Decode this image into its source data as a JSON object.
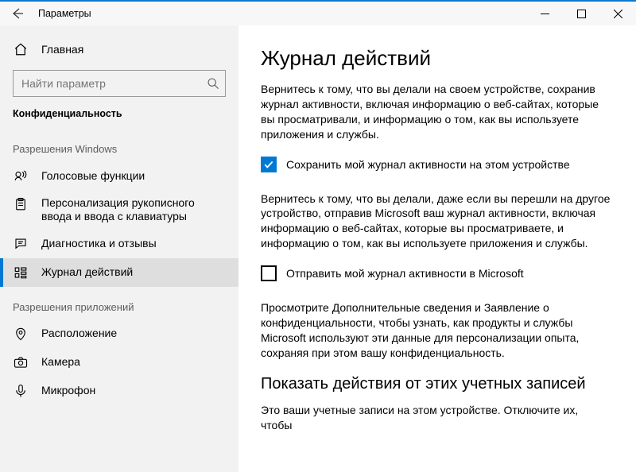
{
  "titlebar": {
    "title": "Параметры"
  },
  "sidebar": {
    "home": "Главная",
    "search_placeholder": "Найти параметр",
    "category": "Конфиденциальность",
    "section_windows": "Разрешения Windows",
    "items_windows": [
      {
        "label": "Голосовые функции"
      },
      {
        "label": "Персонализация рукописного ввода и ввода с клавиатуры"
      },
      {
        "label": "Диагностика и отзывы"
      },
      {
        "label": "Журнал действий"
      }
    ],
    "section_apps": "Разрешения приложений",
    "items_apps": [
      {
        "label": "Расположение"
      },
      {
        "label": "Камера"
      },
      {
        "label": "Микрофон"
      }
    ]
  },
  "content": {
    "title": "Журнал действий",
    "para1": "Вернитесь к тому, что вы делали на своем устройстве, сохранив журнал активности, включая информацию о веб-сайтах, которые вы просматривали, и информацию о том, как вы используете приложения и службы.",
    "cb1_label": "Сохранить мой журнал активности на этом устройстве",
    "cb1_checked": true,
    "para2": "Вернитесь к тому, что вы делали, даже если вы перешли на другое устройство, отправив Microsoft ваш журнал активности, включая информацию о веб-сайтах, которые вы просматриваете, и информацию о том, как вы используете приложения и службы.",
    "cb2_label": "Отправить мой журнал активности в Microsoft",
    "cb2_checked": false,
    "para3": "Просмотрите Дополнительные сведения и Заявление о конфиденциальности, чтобы узнать, как продукты и службы Microsoft используют эти данные для персонализации опыта, сохраняя при этом вашу конфиденциальность.",
    "subheading": "Показать действия от этих учетных записей",
    "para4": "Это ваши учетные записи на этом устройстве. Отключите их, чтобы"
  }
}
